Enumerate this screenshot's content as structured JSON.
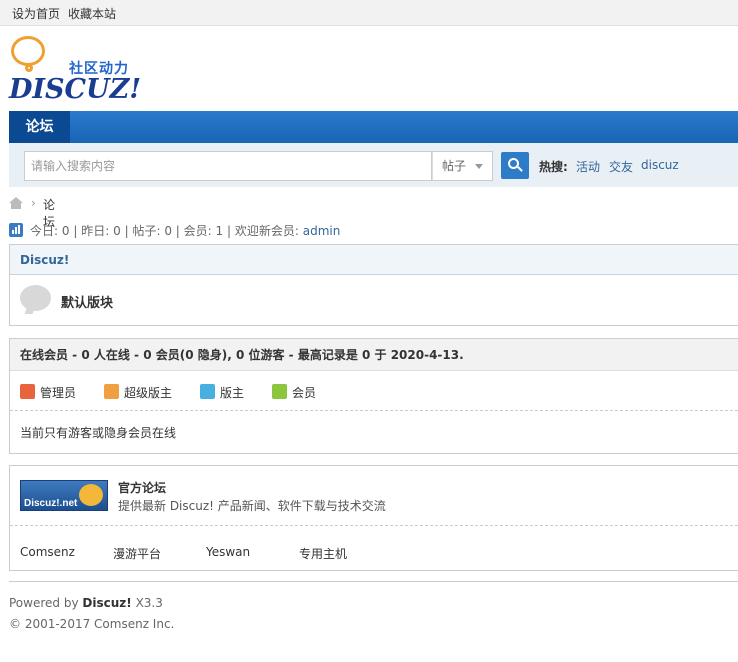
{
  "topbar": {
    "set_home": "设为首页",
    "bookmark": "收藏本站"
  },
  "logo": {
    "slogan": "社区动力",
    "word": "DISCUZ!"
  },
  "nav": {
    "tab": "论坛"
  },
  "search": {
    "placeholder": "请输入搜索内容",
    "type": "帖子",
    "hot_label": "热搜:",
    "hot_links": [
      "活动",
      "交友",
      "discuz"
    ]
  },
  "breadcrumb": {
    "sep": "›",
    "current": "论坛"
  },
  "stats": {
    "today_label": "今日:",
    "today": "0",
    "yesterday_label": "昨日:",
    "yesterday": "0",
    "posts_label": "帖子:",
    "posts": "0",
    "members_label": "会员:",
    "members": "1",
    "welcome_label": "欢迎新会员:",
    "newest": "admin"
  },
  "forum": {
    "category": "Discuz!",
    "board": "默认版块"
  },
  "online": {
    "head": "在线会员 - 0 人在线 - 0 会员(0 隐身), 0 位游客 - 最高记录是 0 于 2020-4-13.",
    "legend": [
      {
        "label": "管理员",
        "color": "#e8643c"
      },
      {
        "label": "超级版主",
        "color": "#f0a040"
      },
      {
        "label": "版主",
        "color": "#48b0e0"
      },
      {
        "label": "会员",
        "color": "#8cc63e"
      }
    ],
    "note": "当前只有游客或隐身会员在线"
  },
  "links": {
    "banner_text": "Discuz!.net",
    "title": "官方论坛",
    "desc": "提供最新 Discuz! 产品新闻、软件下载与技术交流",
    "items": [
      "Comsenz",
      "漫游平台",
      "Yeswan",
      "专用主机"
    ]
  },
  "footer": {
    "powered": "Powered by",
    "brand": "Discuz!",
    "version": "X3.3",
    "copyright": "© 2001-2017 Comsenz Inc."
  }
}
